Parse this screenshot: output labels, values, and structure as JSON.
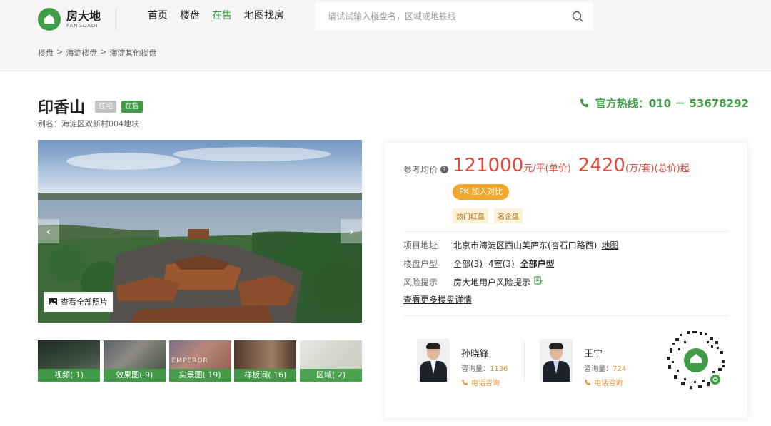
{
  "header": {
    "logo_cn": "房大地",
    "logo_en": "FANGDADI",
    "nav": [
      {
        "label": "首页",
        "active": false
      },
      {
        "label": "楼盘",
        "active": false
      },
      {
        "label": "在售",
        "active": true
      },
      {
        "label": "地图找房",
        "active": false
      }
    ],
    "search_placeholder": "请试试输入楼盘名，区域或地铁线"
  },
  "breadcrumb": [
    "楼盘",
    ">",
    "海淀楼盘",
    ">",
    "海淀其他楼盘"
  ],
  "title": {
    "name": "印香山",
    "tag_type": "住宅",
    "tag_status": "在售",
    "alias": "别名：海淀区双新村004地块"
  },
  "hotline": {
    "label": "官方热线：010 － 53678292"
  },
  "gallery": {
    "view_all": "查看全部照片",
    "thumbs": [
      {
        "label": "视频( 1)"
      },
      {
        "label": "效果图( 9)"
      },
      {
        "label": "实景图( 19)"
      },
      {
        "label": "样板间( 16)"
      },
      {
        "label": "区域( 2)"
      }
    ],
    "thumb3_overlay": "EMPEROR"
  },
  "price": {
    "label": "参考均价",
    "unit_price": "121000",
    "unit_price_unit": "元/平(单价)",
    "total_price": "2420",
    "total_price_unit": "(万/套)(总价)起",
    "pk_label": "PK 加入对比",
    "badges": [
      "热门红盘",
      "名企盘"
    ]
  },
  "info": {
    "address_key": "项目地址",
    "address_val": "北京市海淀区西山美庐东(杏石口路西)",
    "map_link": "地图",
    "layout_key": "楼盘户型",
    "layout_links": [
      "全部(3)",
      "4室(3)"
    ],
    "layout_all": "全部户型",
    "risk_key": "风险提示",
    "risk_val": "房大地用户风险提示",
    "more_link": "查看更多楼盘详情"
  },
  "agents": [
    {
      "name": "孙晓锋",
      "count_label": "咨询量：",
      "count": "1136",
      "phone_label": "电话咨询"
    },
    {
      "name": "王宁",
      "count_label": "咨询量：",
      "count": "724",
      "phone_label": "电话咨询"
    }
  ],
  "colors": {
    "brand_green": "#3f9e45",
    "price_red": "#e04a3b",
    "accent_orange": "#f0a72d"
  }
}
